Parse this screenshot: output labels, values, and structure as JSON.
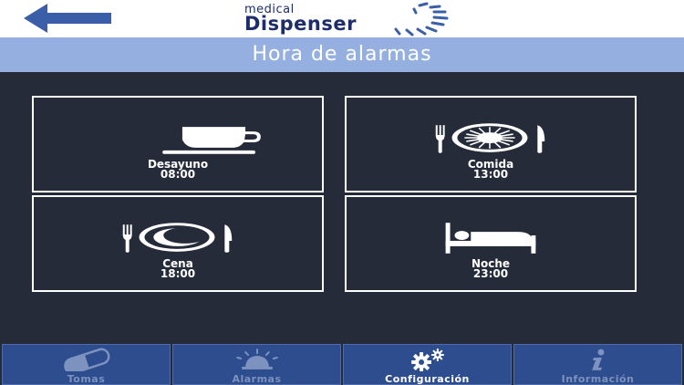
{
  "header": {
    "logo_line1": "medical",
    "logo_line2": "Dispenser"
  },
  "page": {
    "title": "Hora de alarmas"
  },
  "tiles": [
    {
      "name": "Desayuno",
      "time": "08:00",
      "icon": "coffee-cup-icon"
    },
    {
      "name": "Comida",
      "time": "13:00",
      "icon": "lunch-plate-sun-icon"
    },
    {
      "name": "Cena",
      "time": "18:00",
      "icon": "dinner-plate-moon-icon"
    },
    {
      "name": "Noche",
      "time": "23:00",
      "icon": "bed-icon"
    }
  ],
  "tabs": [
    {
      "label": "Tomas",
      "icon": "pill-icon",
      "active": false
    },
    {
      "label": "Alarmas",
      "icon": "alarm-bell-icon",
      "active": false
    },
    {
      "label": "Configuración",
      "icon": "gears-icon",
      "active": true
    },
    {
      "label": "Información",
      "icon": "info-icon",
      "active": false
    }
  ],
  "colors": {
    "background": "#262b3a",
    "title_bar": "#95b0e0",
    "tab_background": "#2d4d8f",
    "brand_blue": "#3a5fa8"
  }
}
